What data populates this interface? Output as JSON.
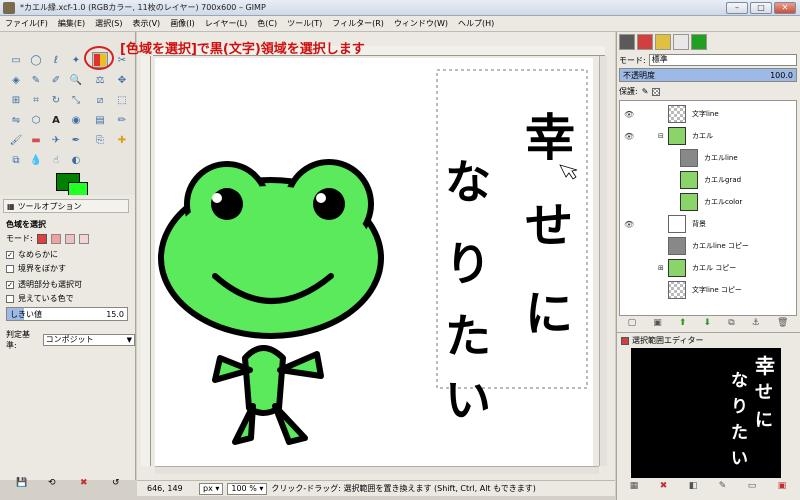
{
  "window": {
    "title": "*カエル縁.xcf-1.0 (RGBカラー, 11枚のレイヤー) 700x600 – GIMP",
    "minimize": "–",
    "maximize": "□",
    "close": "✕"
  },
  "menu": [
    "ファイル(F)",
    "編集(E)",
    "選択(S)",
    "表示(V)",
    "画像(I)",
    "レイヤー(L)",
    "色(C)",
    "ツール(T)",
    "フィルター(R)",
    "ウィンドウ(W)",
    "ヘルプ(H)"
  ],
  "instruction": "[色域を選択]で黒(文字)領域を選択します",
  "tool_options": {
    "tab_label": "ツールオプション",
    "heading": "色域を選択",
    "mode_label": "モード:",
    "antialias": "なめらかに",
    "feather": "境界をぼかす",
    "transparent": "透明部分も選択可",
    "sample_merged": "見えている色で",
    "threshold_label": "しきい値",
    "threshold_value": "15.0",
    "criterion_label": "判定基準:",
    "criterion_value": "コンポジット"
  },
  "canvas": {
    "text_chars": [
      "幸",
      "せ",
      "に",
      "な",
      "り",
      "た",
      "い"
    ]
  },
  "status": {
    "coords": "646, 149",
    "unit": "px",
    "zoom": "100 %",
    "message": "クリック-ドラッグ: 選択範囲を置き換えます (Shift, Ctrl, Alt もできます)"
  },
  "layers": {
    "mode_label": "モード:",
    "mode_value": "標準",
    "opacity_label": "不透明度",
    "opacity_value": "100.0",
    "lock_label": "保護:",
    "items": [
      {
        "name": "文字line"
      },
      {
        "name": "カエル"
      },
      {
        "name": "カエルline"
      },
      {
        "name": "カエルgrad"
      },
      {
        "name": "カエルcolor"
      },
      {
        "name": "背景"
      },
      {
        "name": "カエルline コピー"
      },
      {
        "name": "カエル コピー"
      },
      {
        "name": "文字line コピー"
      }
    ]
  },
  "selection_editor": {
    "title": "選択範囲エディター",
    "preview_chars": [
      "幸",
      "せ",
      "に",
      "な",
      "り",
      "た",
      "い"
    ]
  },
  "colors": {
    "foreground": "#008000",
    "background": "#22ff22",
    "frog_fill": "#5bea5b",
    "instruction_red": "#d01010"
  }
}
